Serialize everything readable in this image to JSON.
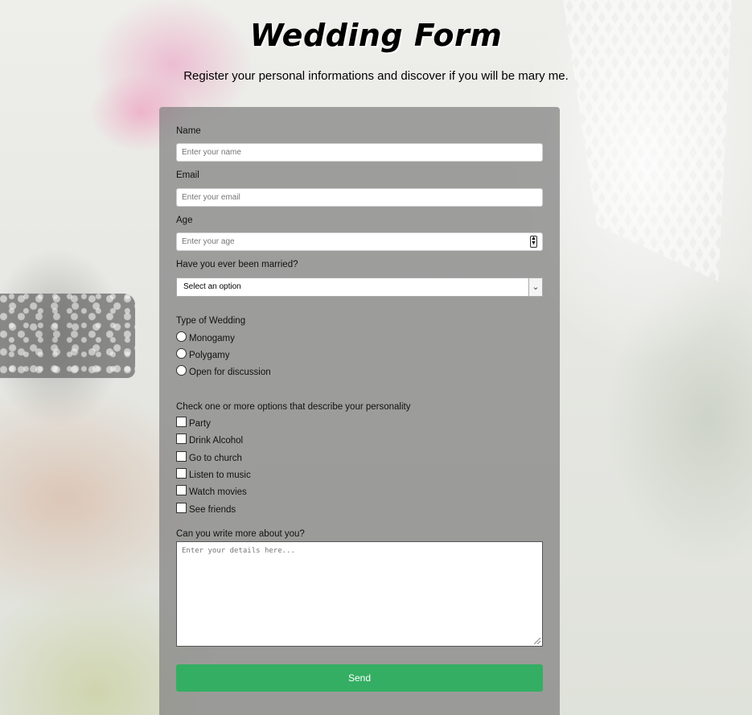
{
  "header": {
    "title": "Wedding Form",
    "subtitle": "Register your personal informations and discover if you will be mary me."
  },
  "form": {
    "name": {
      "label": "Name",
      "placeholder": "Enter your name"
    },
    "email": {
      "label": "Email",
      "placeholder": "Enter your email"
    },
    "age": {
      "label": "Age",
      "placeholder": "Enter your age"
    },
    "married": {
      "label": "Have you ever been married?",
      "selected": "Select an option"
    },
    "wedding_type": {
      "label": "Type of Wedding",
      "options": [
        "Monogamy",
        "Polygamy",
        "Open for discussion"
      ]
    },
    "personality": {
      "label": "Check one or more options that describe your personality",
      "options": [
        "Party",
        "Drink Alcohol",
        "Go to church",
        "Listen to music",
        "Watch movies",
        "See friends"
      ]
    },
    "about": {
      "label": "Can you write more about you?",
      "placeholder": "Enter your details here..."
    },
    "submit_label": "Send"
  },
  "icons": {
    "spinner": "number-spinner-icon",
    "dropdown": "chevron-down-icon",
    "resize": "resize-grip-icon"
  },
  "colors": {
    "send_button": "#34ae63",
    "form_panel": "rgba(128,128,128,0.72)"
  }
}
